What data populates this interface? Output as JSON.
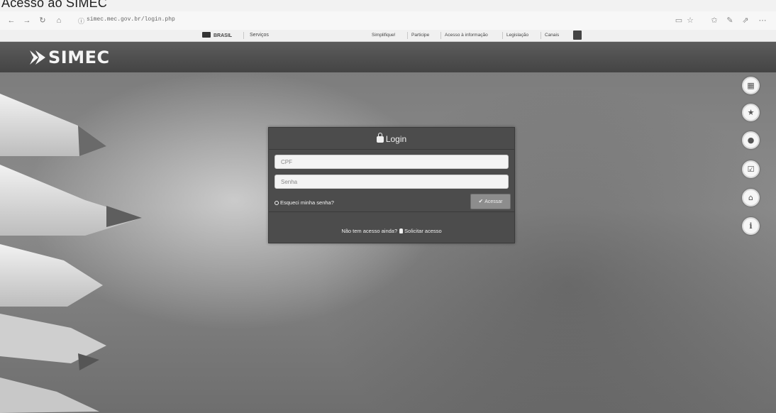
{
  "caption": "Acesso ao SIMEC",
  "browser": {
    "url": "simec.mec.gov.br/login.php",
    "back_icon": "arrow-left-icon",
    "forward_icon": "arrow-right-icon",
    "reload_icon": "reload-icon",
    "home_icon": "home-icon",
    "toolbar_icons": [
      "reading-view-icon",
      "favorite-star-icon",
      "favorites-icon",
      "pen-icon",
      "share-icon",
      "more-icon"
    ]
  },
  "gov_bar": {
    "brasil": "BRASIL",
    "servicos": "Serviços",
    "links": [
      "Simplifique!",
      "Participe",
      "Acesso à informação",
      "Legislação",
      "Canais"
    ]
  },
  "header": {
    "logo_text": "SIMEC"
  },
  "login": {
    "title": "Login",
    "cpf_placeholder": "CPF",
    "password_placeholder": "Senha",
    "forgot_password": "Esqueci minha senha?",
    "submit_label": "Acessar",
    "no_access_text": "Não tem acesso ainda?",
    "request_access": "Solicitar acesso"
  },
  "side_buttons": [
    {
      "icon": "calendar-icon",
      "glyph": "▦"
    },
    {
      "icon": "star-icon",
      "glyph": "★"
    },
    {
      "icon": "chat-icon",
      "glyph": "●"
    },
    {
      "icon": "checkbox-icon",
      "glyph": "☑"
    },
    {
      "icon": "institution-icon",
      "glyph": "⌂"
    },
    {
      "icon": "info-icon",
      "glyph": "i"
    }
  ]
}
